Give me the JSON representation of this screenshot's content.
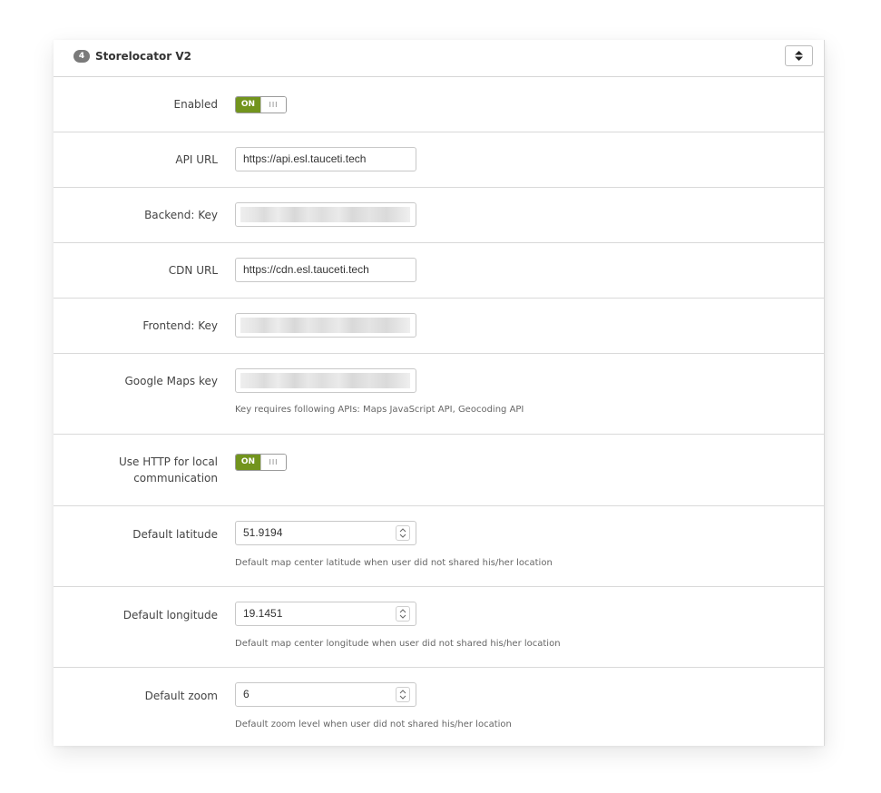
{
  "panel": {
    "badge": "4",
    "title": "Storelocator V2",
    "collapse_icon": "sort-icon"
  },
  "toggle_text": {
    "on": "ON",
    "handle": "III"
  },
  "fields": {
    "enabled": {
      "label": "Enabled",
      "state": "on"
    },
    "api_url": {
      "label": "API URL",
      "value": "https://api.esl.tauceti.tech"
    },
    "backend_key": {
      "label": "Backend: Key"
    },
    "cdn_url": {
      "label": "CDN URL",
      "value": "https://cdn.esl.tauceti.tech"
    },
    "frontend_key": {
      "label": "Frontend: Key"
    },
    "google_maps_key": {
      "label": "Google Maps key",
      "help": "Key requires following APIs: Maps JavaScript API, Geocoding API"
    },
    "use_http": {
      "label_line1": "Use HTTP for local",
      "label_line2": "communication",
      "state": "on"
    },
    "default_latitude": {
      "label": "Default latitude",
      "value": "51.9194",
      "help": "Default map center latitude when user did not shared his/her location"
    },
    "default_longitude": {
      "label": "Default longitude",
      "value": "19.1451",
      "help": "Default map center longitude when user did not shared his/her location"
    },
    "default_zoom": {
      "label": "Default zoom",
      "value": "6",
      "help": "Default zoom level when user did not shared his/her location"
    }
  },
  "colors": {
    "toggle_on": "#72941d",
    "badge": "#7a7a7a",
    "border": "#d9d9d9"
  }
}
